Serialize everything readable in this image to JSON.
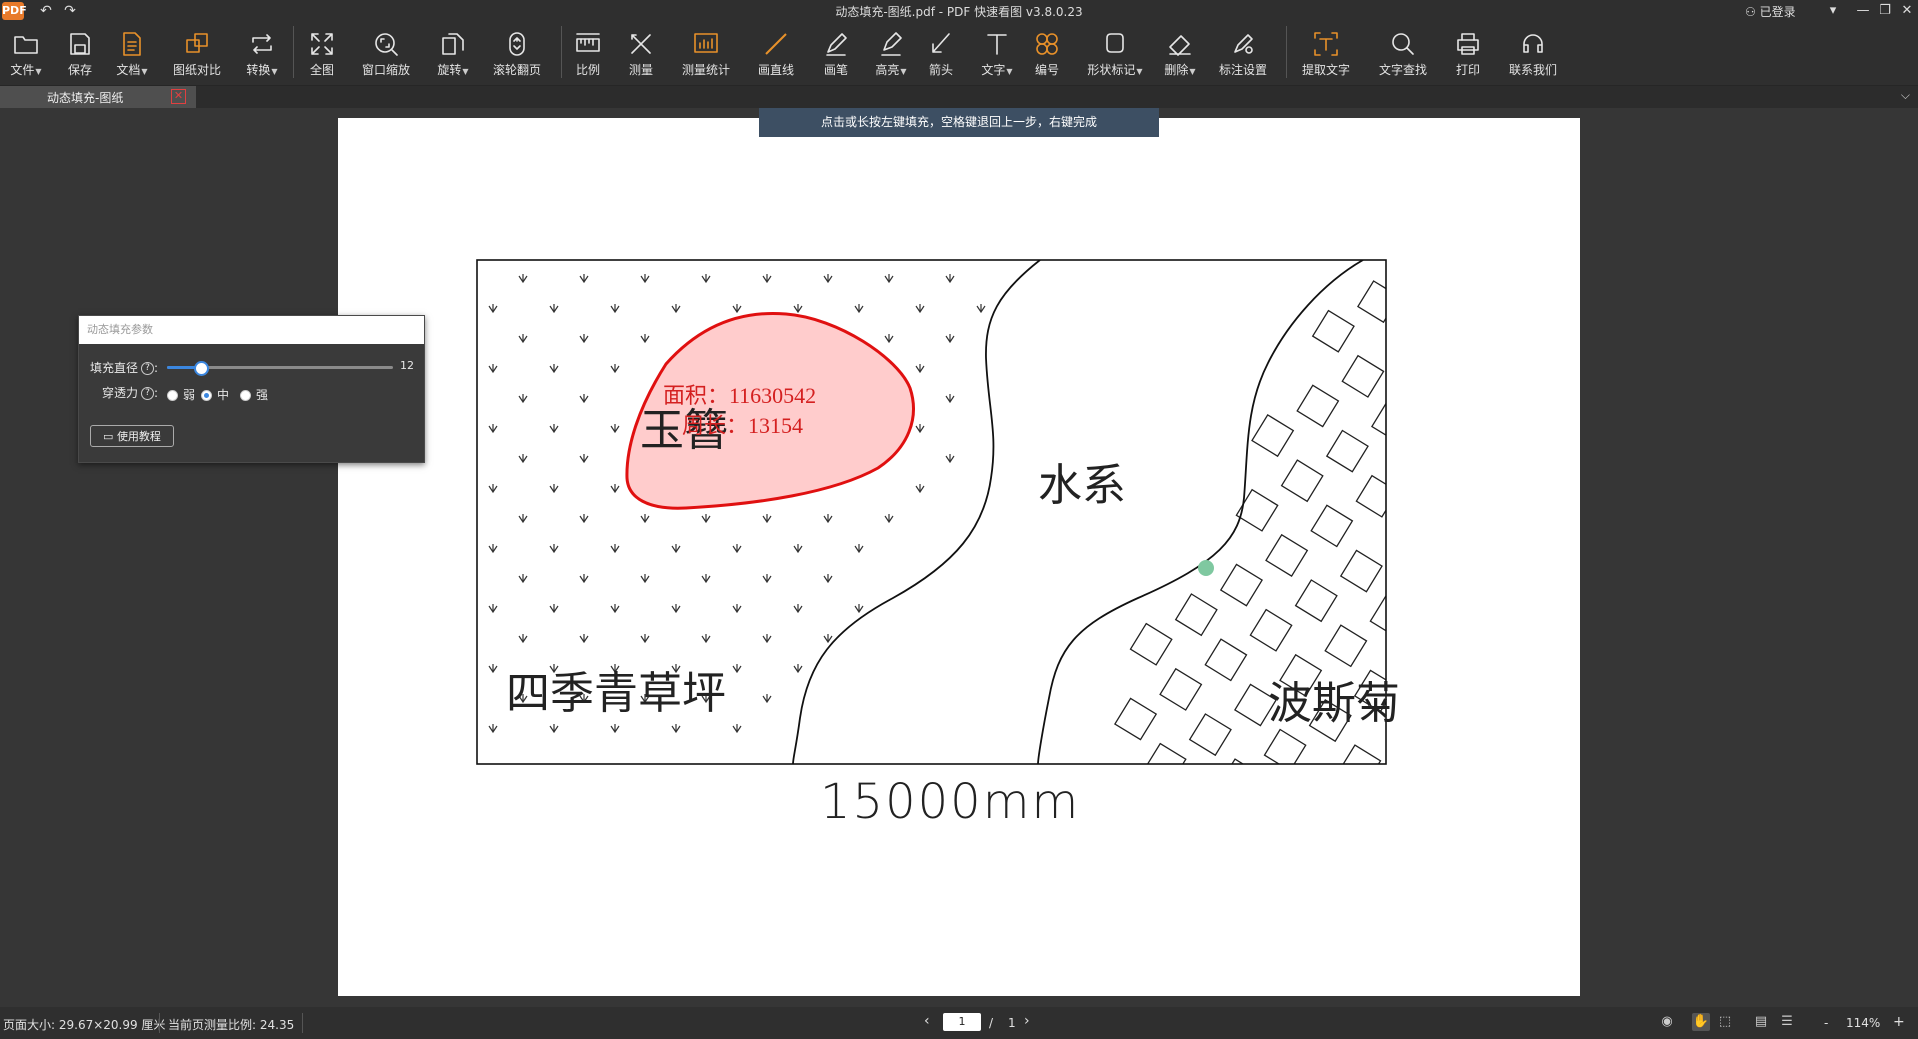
{
  "app": {
    "logo_text": "PDF",
    "window_title": "动态填充-图纸.pdf - PDF 快速看图 v3.8.0.23",
    "login_status": "已登录"
  },
  "toolbar": {
    "items": [
      {
        "label": "文件",
        "icon": "folder-icon",
        "dropdown": true
      },
      {
        "label": "保存",
        "icon": "save-icon",
        "dropdown": false
      },
      {
        "label": "文档",
        "icon": "document-icon",
        "dropdown": true
      },
      {
        "label": "图纸对比",
        "icon": "compare-icon",
        "dropdown": false
      },
      {
        "label": "转换",
        "icon": "convert-icon",
        "dropdown": true
      },
      {
        "label": "全图",
        "icon": "fullview-icon",
        "dropdown": false
      },
      {
        "label": "窗口缩放",
        "icon": "zoom-window-icon",
        "dropdown": false
      },
      {
        "label": "旋转",
        "icon": "rotate-icon",
        "dropdown": true
      },
      {
        "label": "滚轮翻页",
        "icon": "mouse-scroll-icon",
        "dropdown": false
      },
      {
        "label": "比例",
        "icon": "ruler-icon",
        "dropdown": false
      },
      {
        "label": "测量",
        "icon": "measure-icon",
        "dropdown": false
      },
      {
        "label": "测量统计",
        "icon": "measure-stats-icon",
        "dropdown": false
      },
      {
        "label": "画直线",
        "icon": "line-icon",
        "dropdown": false
      },
      {
        "label": "画笔",
        "icon": "pen-icon",
        "dropdown": false
      },
      {
        "label": "高亮",
        "icon": "highlighter-icon",
        "dropdown": true
      },
      {
        "label": "箭头",
        "icon": "arrow-icon",
        "dropdown": false
      },
      {
        "label": "文字",
        "icon": "text-icon",
        "dropdown": true
      },
      {
        "label": "编号",
        "icon": "numbering-icon",
        "dropdown": false
      },
      {
        "label": "形状标记",
        "icon": "shape-mark-icon",
        "dropdown": true
      },
      {
        "label": "删除",
        "icon": "eraser-icon",
        "dropdown": true
      },
      {
        "label": "标注设置",
        "icon": "annotation-settings-icon",
        "dropdown": false
      },
      {
        "label": "提取文字",
        "icon": "extract-text-icon",
        "dropdown": false
      },
      {
        "label": "文字查找",
        "icon": "search-icon",
        "dropdown": false
      },
      {
        "label": "打印",
        "icon": "print-icon",
        "dropdown": false
      },
      {
        "label": "联系我们",
        "icon": "headset-icon",
        "dropdown": false
      }
    ]
  },
  "tab": {
    "label": "动态填充-图纸",
    "close": "✕"
  },
  "hint": "点击或长按左键填充，空格键退回上一步，右键完成",
  "fill_panel": {
    "title": "动态填充参数",
    "diameter_label": "填充直径",
    "diameter_value": "12",
    "diameter_fraction": 0.15,
    "penetration_label": "穿透力",
    "options": [
      "弱",
      "中",
      "强"
    ],
    "selected_option": "中",
    "tutorial_label": "使用教程"
  },
  "drawing": {
    "region_labels": [
      "玉簪",
      "水系",
      "四季青草坪",
      "波斯菊"
    ],
    "area_label": "面积：11630542",
    "perimeter_label": "周长：13154",
    "dimension": "15000mm",
    "fill_color": "#ffcccc",
    "outline_color": "#e01010"
  },
  "status": {
    "page_size": "页面大小: 29.67×20.99 厘米",
    "measure_scale": "当前页测量比例: 24.35",
    "current_page": "1",
    "page_separator": "/",
    "total_pages": "1",
    "zoom": "114%",
    "minus": "-",
    "plus": "+"
  }
}
